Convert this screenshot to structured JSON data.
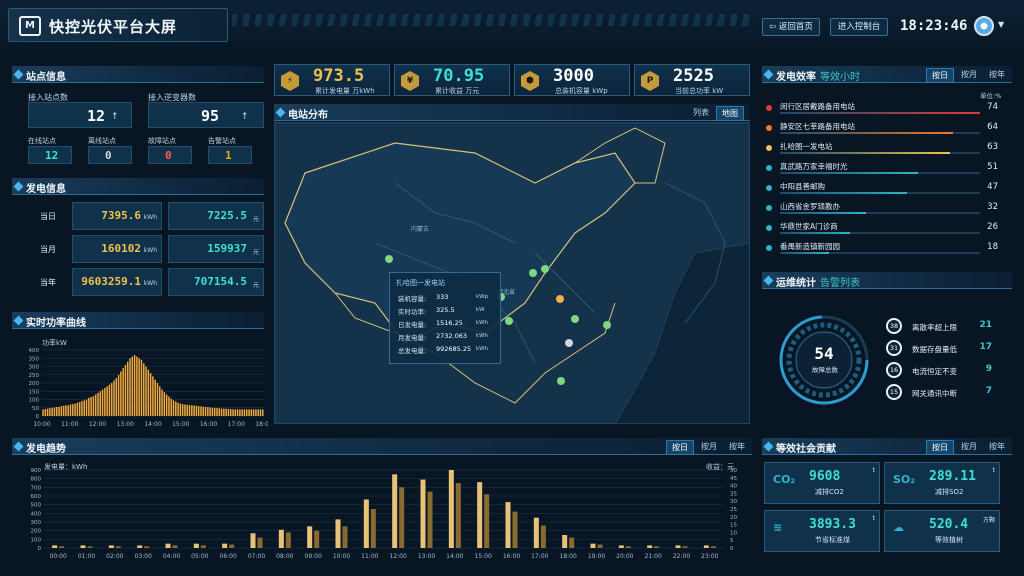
{
  "header": {
    "logo": "M",
    "title": "快控光伏平台大屏",
    "home_btn": "返回首页",
    "console_btn": "进入控制台",
    "clock": "18:23:46"
  },
  "station": {
    "title": "站点信息",
    "connected_label": "接入站点数",
    "connected_value": "12",
    "inverter_label": "接入逆变器数",
    "inverter_value": "95",
    "statuses": [
      {
        "label": "在线站点",
        "value": "12",
        "color": "#3ee0d6"
      },
      {
        "label": "离线站点",
        "value": "0",
        "color": "#cfd8df"
      },
      {
        "label": "故障站点",
        "value": "0",
        "color": "#ff5a5a"
      },
      {
        "label": "告警站点",
        "value": "1",
        "color": "#f5a623"
      }
    ]
  },
  "gen_info": {
    "title": "发电信息",
    "rows": [
      {
        "label": "当日",
        "kwh": "7395.6",
        "kwh_unit": "kWh",
        "yuan": "7225.5",
        "yuan_unit": "元"
      },
      {
        "label": "当月",
        "kwh": "160102",
        "kwh_unit": "kWh",
        "yuan": "159937",
        "yuan_unit": "元"
      },
      {
        "label": "当年",
        "kwh": "9603259.1",
        "kwh_unit": "kWh",
        "yuan": "707154.5",
        "yuan_unit": "元"
      }
    ]
  },
  "power_curve": {
    "title": "实时功率曲线",
    "unit": "功率kW"
  },
  "kpis": [
    {
      "icon": "⚡",
      "value": "973.5",
      "unit": "累计发电量 万kWh",
      "color": "#f2c14e"
    },
    {
      "icon": "¥",
      "value": "70.95",
      "unit": "累计收益 万元",
      "color": "#3ee0d6"
    },
    {
      "icon": "⬢",
      "value": "3000",
      "unit": "总装机容量 kWp",
      "color": "#ffffff"
    },
    {
      "icon": "P",
      "value": "2525",
      "unit": "当前总功率 kW",
      "color": "#ffffff"
    }
  ],
  "map": {
    "title": "电站分布",
    "tab_list": "列表",
    "tab_map": "地图",
    "label_inner_mongolia": "内蒙古",
    "label_hebei": "河北省",
    "popup": {
      "title": "扎哈图一发电站",
      "rows": [
        {
          "k": "装机容量:",
          "v": "333",
          "u": "kWp"
        },
        {
          "k": "实时功率:",
          "v": "325.5",
          "u": "kW"
        },
        {
          "k": "日发电量:",
          "v": "1516.25",
          "u": "kWh"
        },
        {
          "k": "月发电量:",
          "v": "2732.063",
          "u": "kWh"
        },
        {
          "k": "总发电量:",
          "v": "992685.25",
          "u": "kWh"
        }
      ]
    }
  },
  "efficiency": {
    "title": "发电效率",
    "subtitle": "等效小时",
    "tabs": [
      "按日",
      "按月",
      "按年"
    ],
    "unit": "单位:%",
    "items": [
      {
        "name": "闵行区居戴路备用电站",
        "value": 74,
        "color": "#e23b3b"
      },
      {
        "name": "静安区七莘路备用电站",
        "value": 64,
        "color": "#f07a2c"
      },
      {
        "name": "扎哈图一发电站",
        "value": 63,
        "color": "#f2c14e"
      },
      {
        "name": "真武路万家幸福时光",
        "value": 51,
        "color": "#2fb3c9"
      },
      {
        "name": "中阳县善邮购",
        "value": 47,
        "color": "#2fb3c9"
      },
      {
        "name": "山西省金罗琐教办",
        "value": 32,
        "color": "#2fb3c9"
      },
      {
        "name": "华鼎世家A门诊商",
        "value": 26,
        "color": "#2fb3c9"
      },
      {
        "name": "番禺新造镇新园园",
        "value": 18,
        "color": "#2fb3c9"
      }
    ]
  },
  "ops": {
    "title": "运维统计",
    "subtitle": "告警列表",
    "total_value": "54",
    "total_label": "故障总数",
    "items": [
      {
        "code": "38",
        "name": "离散率超上限",
        "value": "21"
      },
      {
        "code": "31",
        "name": "数据存盘量低",
        "value": "17"
      },
      {
        "code": "16",
        "name": "电流恒定不变",
        "value": "9"
      },
      {
        "code": "15",
        "name": "网关通讯中断",
        "value": "7"
      }
    ]
  },
  "social": {
    "title": "等效社会贡献",
    "tabs": [
      "按日",
      "按月",
      "按年"
    ],
    "items": [
      {
        "icon": "CO₂",
        "value": "9608",
        "label": "减排CO2",
        "unit": "t"
      },
      {
        "icon": "SO₂",
        "value": "289.11",
        "label": "减排SO2",
        "unit": "t"
      },
      {
        "icon": "≋",
        "value": "3893.3",
        "label": "节省标准煤",
        "unit": "t"
      },
      {
        "icon": "☁",
        "value": "520.4",
        "label": "等效植树",
        "unit": "万颗"
      }
    ]
  },
  "trend": {
    "title": "发电趋势",
    "tabs": [
      "按日",
      "按月",
      "按年"
    ],
    "left_unit": "发电量：kWh",
    "right_unit": "收益：元"
  },
  "chart_data": [
    {
      "type": "bar",
      "title": "实时功率曲线",
      "ylabel": "功率kW",
      "ylim": [
        0,
        400
      ],
      "x": [
        "10:00",
        "10:05",
        "10:10",
        "10:15",
        "10:20",
        "10:25",
        "10:30",
        "10:35",
        "10:40",
        "10:45",
        "10:50",
        "10:55",
        "11:00",
        "11:05",
        "11:10",
        "11:15",
        "11:20",
        "11:25",
        "11:30",
        "11:35",
        "11:40",
        "11:45",
        "11:50",
        "11:55",
        "12:00",
        "12:05",
        "12:10",
        "12:15",
        "12:20",
        "12:25",
        "12:30",
        "12:35",
        "12:40",
        "12:45",
        "12:50",
        "12:55",
        "13:00",
        "13:05",
        "13:10",
        "13:15",
        "13:20",
        "13:25",
        "13:30",
        "13:35",
        "13:40",
        "13:45",
        "13:50",
        "13:55",
        "14:00",
        "14:05",
        "14:10",
        "14:15",
        "14:20",
        "14:25",
        "14:30",
        "14:35",
        "14:40",
        "14:45",
        "14:50",
        "14:55",
        "15:00",
        "15:05",
        "15:10",
        "15:15",
        "15:20",
        "15:25",
        "15:30",
        "15:35",
        "15:40",
        "15:45",
        "15:50",
        "15:55",
        "16:00",
        "16:05",
        "16:10",
        "16:15",
        "16:20",
        "16:25",
        "16:30",
        "16:35",
        "16:40",
        "16:45",
        "16:50",
        "16:55",
        "17:00",
        "17:05",
        "17:10",
        "17:15",
        "17:20",
        "17:25",
        "17:30",
        "17:35",
        "17:40",
        "17:45",
        "17:50",
        "17:55",
        "18:00"
      ],
      "x_ticks": [
        "10:00",
        "11:00",
        "12:00",
        "13:00",
        "14:00",
        "15:00",
        "16:00",
        "17:00",
        "18:00"
      ],
      "y_ticks": [
        "0",
        "50",
        "100",
        "150",
        "200",
        "250",
        "300",
        "350",
        "400"
      ],
      "values": [
        40,
        42,
        45,
        48,
        50,
        52,
        55,
        55,
        60,
        62,
        65,
        65,
        70,
        72,
        75,
        80,
        85,
        90,
        95,
        100,
        110,
        115,
        120,
        130,
        140,
        150,
        160,
        170,
        180,
        190,
        200,
        215,
        230,
        250,
        270,
        290,
        310,
        330,
        350,
        360,
        370,
        360,
        350,
        340,
        320,
        300,
        280,
        260,
        240,
        220,
        200,
        180,
        160,
        145,
        130,
        118,
        105,
        95,
        88,
        80,
        75,
        72,
        70,
        68,
        66,
        65,
        64,
        62,
        60,
        58,
        56,
        55,
        54,
        52,
        50,
        50,
        48,
        47,
        46,
        45,
        44,
        43,
        42,
        41,
        40,
        40,
        40,
        40,
        40,
        40,
        40,
        40,
        40,
        40,
        40,
        40,
        40
      ]
    },
    {
      "type": "bar",
      "title": "发电趋势",
      "xlabel": "",
      "ylabel": "发电量：kWh",
      "y2label": "收益：元",
      "categories": [
        "00:00",
        "01:00",
        "02:00",
        "03:00",
        "04:00",
        "05:00",
        "06:00",
        "07:00",
        "08:00",
        "09:00",
        "10:00",
        "11:00",
        "12:00",
        "13:00",
        "14:00",
        "15:00",
        "16:00",
        "17:00",
        "18:00",
        "19:00",
        "20:00",
        "21:00",
        "22:00",
        "23:00"
      ],
      "ylim": [
        0,
        900
      ],
      "y2lim": [
        0,
        50
      ],
      "y_ticks": [
        "0",
        "100",
        "200",
        "300",
        "400",
        "500",
        "600",
        "700",
        "800",
        "900"
      ],
      "y2_ticks": [
        "0",
        "5",
        "10",
        "15",
        "20",
        "25",
        "30",
        "35",
        "40",
        "45",
        "50"
      ],
      "series": [
        {
          "values": [
            30,
            30,
            30,
            30,
            50,
            50,
            50,
            170,
            210,
            250,
            330,
            560,
            850,
            790,
            900,
            760,
            530,
            350,
            150,
            50,
            30,
            30,
            30,
            30
          ]
        },
        {
          "values": [
            20,
            20,
            20,
            20,
            30,
            30,
            40,
            120,
            180,
            200,
            250,
            450,
            700,
            650,
            750,
            620,
            420,
            260,
            120,
            40,
            20,
            20,
            20,
            20
          ]
        }
      ]
    }
  ]
}
